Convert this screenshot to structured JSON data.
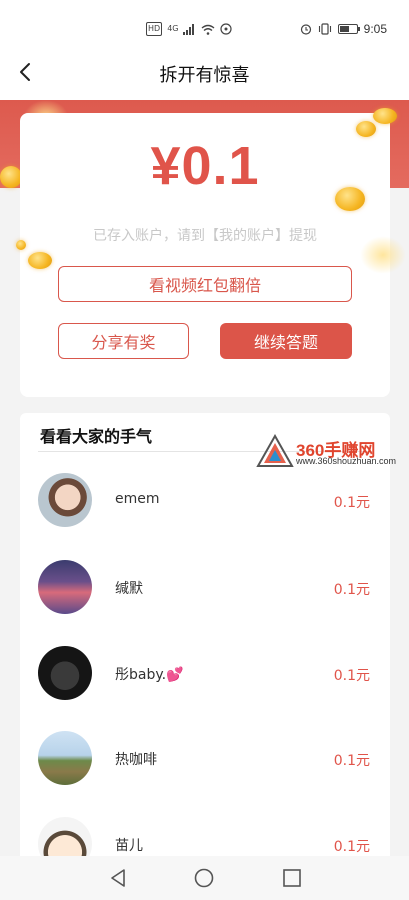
{
  "status_bar": {
    "left_icons": [
      "HD",
      "4G",
      "signal-icon",
      "wifi-icon",
      "nfc-icon"
    ],
    "right_icons": [
      "alarm-icon",
      "vibrate-icon",
      "battery-icon"
    ],
    "time": "9:05"
  },
  "nav": {
    "title": "拆开有惊喜"
  },
  "reward": {
    "amount": "¥0.1",
    "stored_tip": "已存入账户，请到【我的账户】提现",
    "video_button": "看视频红包翻倍",
    "share_button": "分享有奖",
    "continue_button": "继续答题"
  },
  "list": {
    "title": "看看大家的手气",
    "rows": [
      {
        "name": "emem",
        "amount": "0.1元"
      },
      {
        "name": "缄默",
        "amount": "0.1元"
      },
      {
        "name": "彤baby.💕",
        "amount": "0.1元"
      },
      {
        "name": "热咖啡",
        "amount": "0.1元"
      },
      {
        "name": "苗儿",
        "amount": "0.1元"
      }
    ]
  },
  "watermark": {
    "name": "360手赚网",
    "url": "www.360shouzhuan.com"
  },
  "colors": {
    "accent": "#dc5549",
    "band": "#e0625a"
  }
}
